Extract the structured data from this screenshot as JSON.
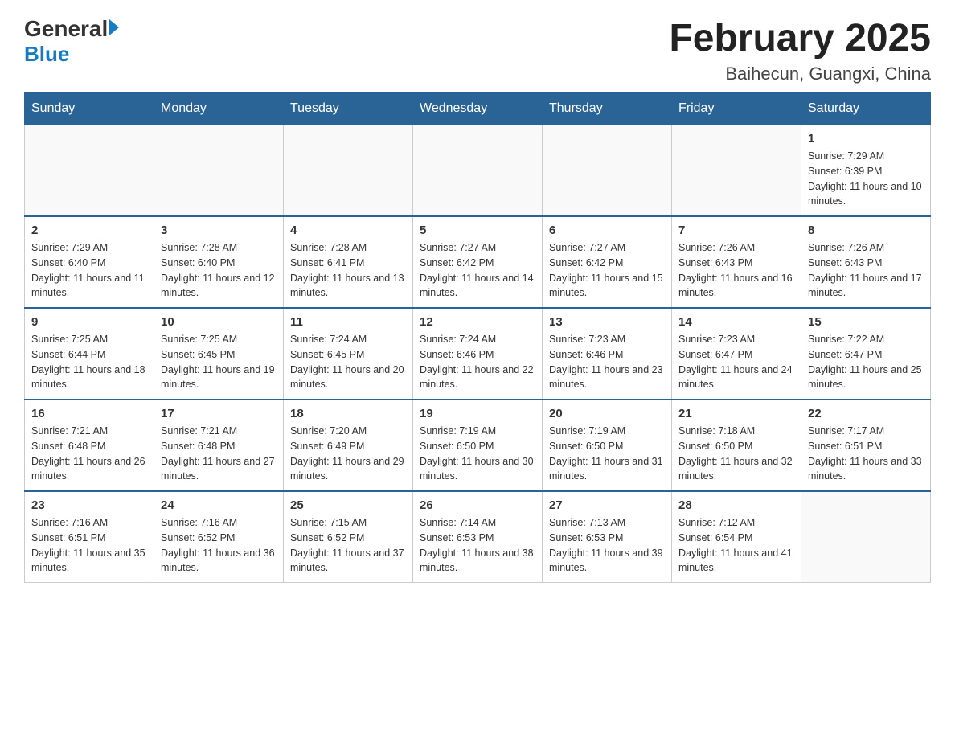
{
  "header": {
    "logo_general": "General",
    "logo_blue": "Blue",
    "month_title": "February 2025",
    "location": "Baihecun, Guangxi, China"
  },
  "days_of_week": [
    "Sunday",
    "Monday",
    "Tuesday",
    "Wednesday",
    "Thursday",
    "Friday",
    "Saturday"
  ],
  "weeks": [
    [
      {
        "day": "",
        "sunrise": "",
        "sunset": "",
        "daylight": ""
      },
      {
        "day": "",
        "sunrise": "",
        "sunset": "",
        "daylight": ""
      },
      {
        "day": "",
        "sunrise": "",
        "sunset": "",
        "daylight": ""
      },
      {
        "day": "",
        "sunrise": "",
        "sunset": "",
        "daylight": ""
      },
      {
        "day": "",
        "sunrise": "",
        "sunset": "",
        "daylight": ""
      },
      {
        "day": "",
        "sunrise": "",
        "sunset": "",
        "daylight": ""
      },
      {
        "day": "1",
        "sunrise": "Sunrise: 7:29 AM",
        "sunset": "Sunset: 6:39 PM",
        "daylight": "Daylight: 11 hours and 10 minutes."
      }
    ],
    [
      {
        "day": "2",
        "sunrise": "Sunrise: 7:29 AM",
        "sunset": "Sunset: 6:40 PM",
        "daylight": "Daylight: 11 hours and 11 minutes."
      },
      {
        "day": "3",
        "sunrise": "Sunrise: 7:28 AM",
        "sunset": "Sunset: 6:40 PM",
        "daylight": "Daylight: 11 hours and 12 minutes."
      },
      {
        "day": "4",
        "sunrise": "Sunrise: 7:28 AM",
        "sunset": "Sunset: 6:41 PM",
        "daylight": "Daylight: 11 hours and 13 minutes."
      },
      {
        "day": "5",
        "sunrise": "Sunrise: 7:27 AM",
        "sunset": "Sunset: 6:42 PM",
        "daylight": "Daylight: 11 hours and 14 minutes."
      },
      {
        "day": "6",
        "sunrise": "Sunrise: 7:27 AM",
        "sunset": "Sunset: 6:42 PM",
        "daylight": "Daylight: 11 hours and 15 minutes."
      },
      {
        "day": "7",
        "sunrise": "Sunrise: 7:26 AM",
        "sunset": "Sunset: 6:43 PM",
        "daylight": "Daylight: 11 hours and 16 minutes."
      },
      {
        "day": "8",
        "sunrise": "Sunrise: 7:26 AM",
        "sunset": "Sunset: 6:43 PM",
        "daylight": "Daylight: 11 hours and 17 minutes."
      }
    ],
    [
      {
        "day": "9",
        "sunrise": "Sunrise: 7:25 AM",
        "sunset": "Sunset: 6:44 PM",
        "daylight": "Daylight: 11 hours and 18 minutes."
      },
      {
        "day": "10",
        "sunrise": "Sunrise: 7:25 AM",
        "sunset": "Sunset: 6:45 PM",
        "daylight": "Daylight: 11 hours and 19 minutes."
      },
      {
        "day": "11",
        "sunrise": "Sunrise: 7:24 AM",
        "sunset": "Sunset: 6:45 PM",
        "daylight": "Daylight: 11 hours and 20 minutes."
      },
      {
        "day": "12",
        "sunrise": "Sunrise: 7:24 AM",
        "sunset": "Sunset: 6:46 PM",
        "daylight": "Daylight: 11 hours and 22 minutes."
      },
      {
        "day": "13",
        "sunrise": "Sunrise: 7:23 AM",
        "sunset": "Sunset: 6:46 PM",
        "daylight": "Daylight: 11 hours and 23 minutes."
      },
      {
        "day": "14",
        "sunrise": "Sunrise: 7:23 AM",
        "sunset": "Sunset: 6:47 PM",
        "daylight": "Daylight: 11 hours and 24 minutes."
      },
      {
        "day": "15",
        "sunrise": "Sunrise: 7:22 AM",
        "sunset": "Sunset: 6:47 PM",
        "daylight": "Daylight: 11 hours and 25 minutes."
      }
    ],
    [
      {
        "day": "16",
        "sunrise": "Sunrise: 7:21 AM",
        "sunset": "Sunset: 6:48 PM",
        "daylight": "Daylight: 11 hours and 26 minutes."
      },
      {
        "day": "17",
        "sunrise": "Sunrise: 7:21 AM",
        "sunset": "Sunset: 6:48 PM",
        "daylight": "Daylight: 11 hours and 27 minutes."
      },
      {
        "day": "18",
        "sunrise": "Sunrise: 7:20 AM",
        "sunset": "Sunset: 6:49 PM",
        "daylight": "Daylight: 11 hours and 29 minutes."
      },
      {
        "day": "19",
        "sunrise": "Sunrise: 7:19 AM",
        "sunset": "Sunset: 6:50 PM",
        "daylight": "Daylight: 11 hours and 30 minutes."
      },
      {
        "day": "20",
        "sunrise": "Sunrise: 7:19 AM",
        "sunset": "Sunset: 6:50 PM",
        "daylight": "Daylight: 11 hours and 31 minutes."
      },
      {
        "day": "21",
        "sunrise": "Sunrise: 7:18 AM",
        "sunset": "Sunset: 6:50 PM",
        "daylight": "Daylight: 11 hours and 32 minutes."
      },
      {
        "day": "22",
        "sunrise": "Sunrise: 7:17 AM",
        "sunset": "Sunset: 6:51 PM",
        "daylight": "Daylight: 11 hours and 33 minutes."
      }
    ],
    [
      {
        "day": "23",
        "sunrise": "Sunrise: 7:16 AM",
        "sunset": "Sunset: 6:51 PM",
        "daylight": "Daylight: 11 hours and 35 minutes."
      },
      {
        "day": "24",
        "sunrise": "Sunrise: 7:16 AM",
        "sunset": "Sunset: 6:52 PM",
        "daylight": "Daylight: 11 hours and 36 minutes."
      },
      {
        "day": "25",
        "sunrise": "Sunrise: 7:15 AM",
        "sunset": "Sunset: 6:52 PM",
        "daylight": "Daylight: 11 hours and 37 minutes."
      },
      {
        "day": "26",
        "sunrise": "Sunrise: 7:14 AM",
        "sunset": "Sunset: 6:53 PM",
        "daylight": "Daylight: 11 hours and 38 minutes."
      },
      {
        "day": "27",
        "sunrise": "Sunrise: 7:13 AM",
        "sunset": "Sunset: 6:53 PM",
        "daylight": "Daylight: 11 hours and 39 minutes."
      },
      {
        "day": "28",
        "sunrise": "Sunrise: 7:12 AM",
        "sunset": "Sunset: 6:54 PM",
        "daylight": "Daylight: 11 hours and 41 minutes."
      },
      {
        "day": "",
        "sunrise": "",
        "sunset": "",
        "daylight": ""
      }
    ]
  ]
}
